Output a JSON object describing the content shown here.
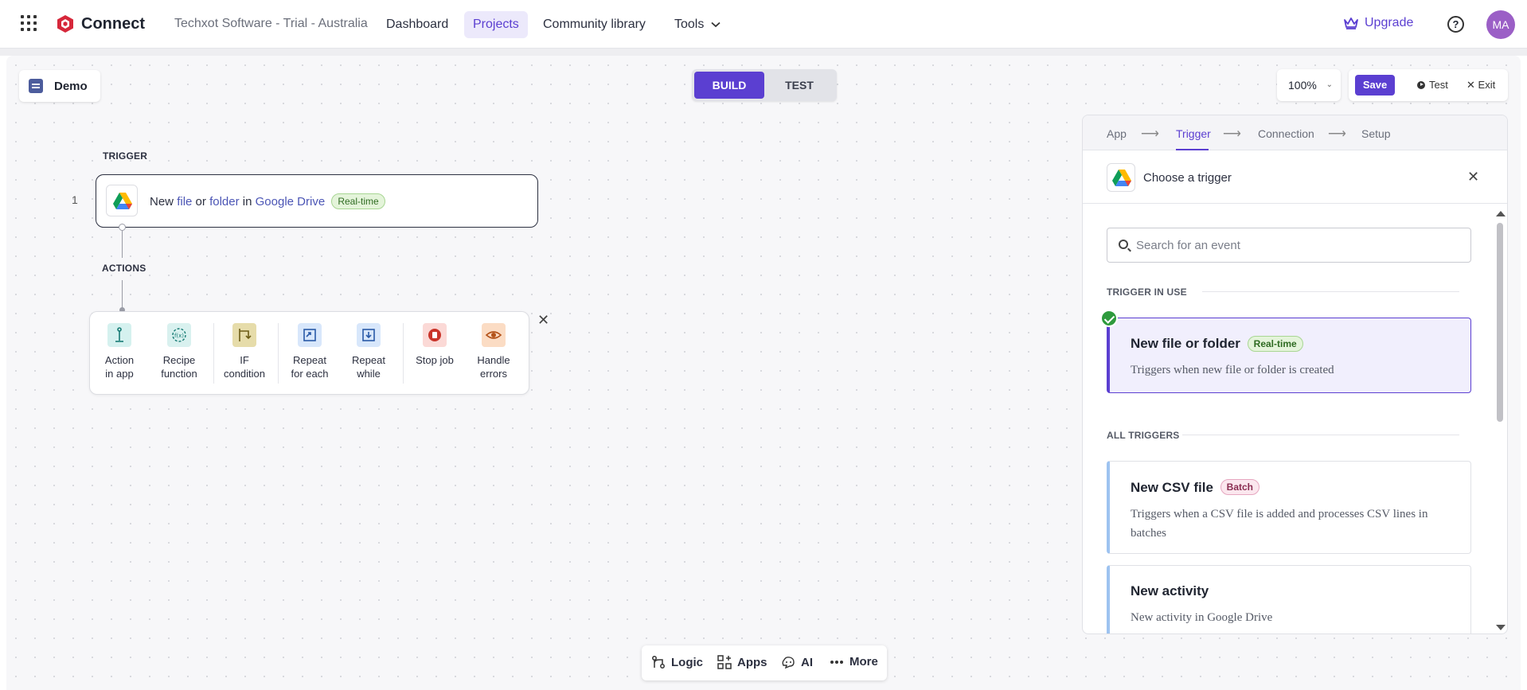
{
  "app": {
    "brand": "Connect",
    "tenant": "Techxot Software - Trial - Australia"
  },
  "nav": {
    "items": [
      "Dashboard",
      "Projects",
      "Community library",
      "Tools"
    ],
    "active": "Projects"
  },
  "header": {
    "upgrade": "Upgrade",
    "help": "?",
    "avatar_initials": "MA"
  },
  "toolbar": {
    "recipe_name": "Demo",
    "modes": [
      "BUILD",
      "TEST"
    ],
    "active_mode": "BUILD",
    "zoom": "100%",
    "save_label": "Save",
    "test_label": "Test",
    "exit_label": "Exit"
  },
  "recipe": {
    "trigger_label": "TRIGGER",
    "actions_label": "ACTIONS",
    "step_number": "1",
    "trigger": {
      "word_new": "New",
      "word_file": "file",
      "word_or": "or",
      "word_folder": "folder",
      "word_in": "in",
      "app_name": "Google Drive",
      "badge": "Real-time"
    },
    "action_picker": [
      {
        "line1": "Action",
        "line2": "in app",
        "icon": "action-in-app-icon",
        "color": "#d5f1ef"
      },
      {
        "line1": "Recipe",
        "line2": "function",
        "icon": "recipe-function-icon",
        "color": "#d9f1ef"
      },
      {
        "line1": "IF",
        "line2": "condition",
        "icon": "if-condition-icon",
        "color": "#e6dcaa"
      },
      {
        "line1": "Repeat",
        "line2": "for each",
        "icon": "repeat-for-each-icon",
        "color": "#d8e7fb"
      },
      {
        "line1": "Repeat",
        "line2": "while",
        "icon": "repeat-while-icon",
        "color": "#d8e7fb"
      },
      {
        "line1": "Stop job",
        "line2": "",
        "icon": "stop-job-icon",
        "color": "#fbd9d6"
      },
      {
        "line1": "Handle",
        "line2": "errors",
        "icon": "handle-errors-icon",
        "color": "#fbdcc4"
      }
    ]
  },
  "panel": {
    "wizard": [
      "App",
      "Trigger",
      "Connection",
      "Setup"
    ],
    "active_step": "Trigger",
    "title": "Choose a trigger",
    "search_placeholder": "Search for an event",
    "in_use_label": "TRIGGER IN USE",
    "all_label": "ALL TRIGGERS",
    "in_use": {
      "title": "New file or folder",
      "badge": "Real-time",
      "desc": "Triggers when new file or folder is created"
    },
    "triggers": [
      {
        "title": "New CSV file",
        "badge": "Batch",
        "desc": "Triggers when a CSV file is added and processes CSV lines in batches"
      },
      {
        "title": "New activity",
        "badge": "",
        "desc": "New activity in Google Drive"
      }
    ]
  },
  "bottom_bar": [
    "Logic",
    "Apps",
    "AI",
    "More"
  ],
  "colors": {
    "accent": "#5b3fd1",
    "success": "#2e9a3d"
  }
}
